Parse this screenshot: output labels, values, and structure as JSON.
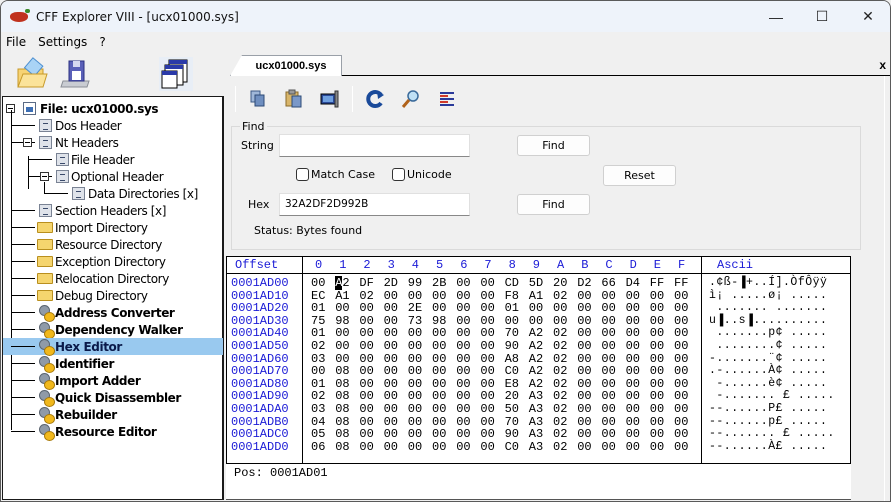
{
  "window": {
    "title": "CFF Explorer VIII - [ucx01000.sys]",
    "controls": {
      "minimize": "—",
      "maximize": "☐",
      "close": "✕"
    }
  },
  "menu": [
    "File",
    "Settings",
    "?"
  ],
  "left_toolbar": [
    "open-icon",
    "save-icon",
    "windows-icon"
  ],
  "tree": {
    "root": "File: ucx01000.sys",
    "items": [
      {
        "label": "Dos Header",
        "level": 1,
        "icon": "doc"
      },
      {
        "label": "Nt Headers",
        "level": 1,
        "icon": "doc",
        "expanded": true
      },
      {
        "label": "File Header",
        "level": 2,
        "icon": "doc"
      },
      {
        "label": "Optional Header",
        "level": 2,
        "icon": "doc",
        "expanded": true
      },
      {
        "label": "Data Directories [x]",
        "level": 3,
        "icon": "doc"
      },
      {
        "label": "Section Headers [x]",
        "level": 1,
        "icon": "doc"
      },
      {
        "label": "Import Directory",
        "level": 1,
        "icon": "folder"
      },
      {
        "label": "Resource Directory",
        "level": 1,
        "icon": "folder"
      },
      {
        "label": "Exception Directory",
        "level": 1,
        "icon": "folder"
      },
      {
        "label": "Relocation Directory",
        "level": 1,
        "icon": "folder"
      },
      {
        "label": "Debug Directory",
        "level": 1,
        "icon": "folder"
      },
      {
        "label": "Address Converter",
        "level": 1,
        "icon": "tool"
      },
      {
        "label": "Dependency Walker",
        "level": 1,
        "icon": "tool"
      },
      {
        "label": "Hex Editor",
        "level": 1,
        "icon": "tool",
        "selected": true
      },
      {
        "label": "Identifier",
        "level": 1,
        "icon": "tool"
      },
      {
        "label": "Import Adder",
        "level": 1,
        "icon": "tool"
      },
      {
        "label": "Quick Disassembler",
        "level": 1,
        "icon": "tool"
      },
      {
        "label": "Rebuilder",
        "level": 1,
        "icon": "tool"
      },
      {
        "label": "Resource Editor",
        "level": 1,
        "icon": "tool"
      }
    ]
  },
  "tab": {
    "label": "ucx01000.sys",
    "close": "x"
  },
  "hex_toolbar": [
    "copy-icon",
    "paste-icon",
    "select-block-icon",
    "refresh-icon",
    "search-icon",
    "editor-icon"
  ],
  "find": {
    "group_label": "Find",
    "string_label": "String",
    "string_value": "",
    "find_string_button": "Find",
    "match_case_label": "Match Case",
    "match_case_checked": false,
    "unicode_label": "Unicode",
    "unicode_checked": false,
    "reset_button": "Reset",
    "hex_label": "Hex",
    "hex_value": "32A2DF2D992B",
    "find_hex_button": "Find",
    "status": "Status: Bytes found"
  },
  "hex": {
    "offset_header": "Offset",
    "column_headers": [
      "0",
      "1",
      "2",
      "3",
      "4",
      "5",
      "6",
      "7",
      "8",
      "9",
      "A",
      "B",
      "C",
      "D",
      "E",
      "F"
    ],
    "ascii_header": "Ascii",
    "cursor": {
      "row": 0,
      "col": 1
    },
    "rows": [
      {
        "offset": "0001AD00",
        "bytes": [
          "00",
          "A2",
          "DF",
          "2D",
          "99",
          "2B",
          "00",
          "00",
          "CD",
          "5D",
          "20",
          "D2",
          "66",
          "D4",
          "FF",
          "FF"
        ],
        "ascii": ".¢ß-▐+..Í].ÒfÔÿÿ"
      },
      {
        "offset": "0001AD10",
        "bytes": [
          "EC",
          "A1",
          "02",
          "00",
          "00",
          "00",
          "00",
          "00",
          "F8",
          "A1",
          "02",
          "00",
          "00",
          "00",
          "00",
          "00"
        ],
        "ascii": "ì¡ .....ø¡ ....."
      },
      {
        "offset": "0001AD20",
        "bytes": [
          "01",
          "00",
          "00",
          "00",
          "2E",
          "00",
          "00",
          "00",
          "01",
          "00",
          "00",
          "00",
          "00",
          "00",
          "00",
          "00"
        ],
        "ascii": " ....... ......."
      },
      {
        "offset": "0001AD30",
        "bytes": [
          "75",
          "98",
          "00",
          "00",
          "73",
          "98",
          "00",
          "00",
          "00",
          "00",
          "00",
          "00",
          "00",
          "00",
          "00",
          "00"
        ],
        "ascii": "u▐..s▐.........."
      },
      {
        "offset": "0001AD40",
        "bytes": [
          "01",
          "00",
          "00",
          "00",
          "00",
          "00",
          "00",
          "00",
          "70",
          "A2",
          "02",
          "00",
          "00",
          "00",
          "00",
          "00"
        ],
        "ascii": " .......p¢ ....."
      },
      {
        "offset": "0001AD50",
        "bytes": [
          "02",
          "00",
          "00",
          "00",
          "00",
          "00",
          "00",
          "00",
          "90",
          "A2",
          "02",
          "00",
          "00",
          "00",
          "00",
          "00"
        ],
        "ascii": " ........¢ ....."
      },
      {
        "offset": "0001AD60",
        "bytes": [
          "03",
          "00",
          "00",
          "00",
          "00",
          "00",
          "00",
          "00",
          "A8",
          "A2",
          "02",
          "00",
          "00",
          "00",
          "00",
          "00"
        ],
        "ascii": "-.......¨¢ ....."
      },
      {
        "offset": "0001AD70",
        "bytes": [
          "00",
          "08",
          "00",
          "00",
          "00",
          "00",
          "00",
          "00",
          "C0",
          "A2",
          "02",
          "00",
          "00",
          "00",
          "00",
          "00"
        ],
        "ascii": ".-......À¢ ....."
      },
      {
        "offset": "0001AD80",
        "bytes": [
          "01",
          "08",
          "00",
          "00",
          "00",
          "00",
          "00",
          "00",
          "E8",
          "A2",
          "02",
          "00",
          "00",
          "00",
          "00",
          "00"
        ],
        "ascii": " -......è¢ ....."
      },
      {
        "offset": "0001AD90",
        "bytes": [
          "02",
          "08",
          "00",
          "00",
          "00",
          "00",
          "00",
          "00",
          "20",
          "A3",
          "02",
          "00",
          "00",
          "00",
          "00",
          "00"
        ],
        "ascii": " -....... £ ....."
      },
      {
        "offset": "0001ADA0",
        "bytes": [
          "03",
          "08",
          "00",
          "00",
          "00",
          "00",
          "00",
          "00",
          "50",
          "A3",
          "02",
          "00",
          "00",
          "00",
          "00",
          "00"
        ],
        "ascii": "--......P£ ....."
      },
      {
        "offset": "0001ADB0",
        "bytes": [
          "04",
          "08",
          "00",
          "00",
          "00",
          "00",
          "00",
          "00",
          "70",
          "A3",
          "02",
          "00",
          "00",
          "00",
          "00",
          "00"
        ],
        "ascii": "--......p£ ....."
      },
      {
        "offset": "0001ADC0",
        "bytes": [
          "05",
          "08",
          "00",
          "00",
          "00",
          "00",
          "00",
          "00",
          "90",
          "A3",
          "02",
          "00",
          "00",
          "00",
          "00",
          "00"
        ],
        "ascii": "--....... £ ....."
      },
      {
        "offset": "0001ADD0",
        "bytes": [
          "06",
          "08",
          "00",
          "00",
          "00",
          "00",
          "00",
          "00",
          "C0",
          "A3",
          "02",
          "00",
          "00",
          "00",
          "00",
          "00"
        ],
        "ascii": "--......À£ ....."
      }
    ]
  },
  "position": "Pos:  0001AD01"
}
